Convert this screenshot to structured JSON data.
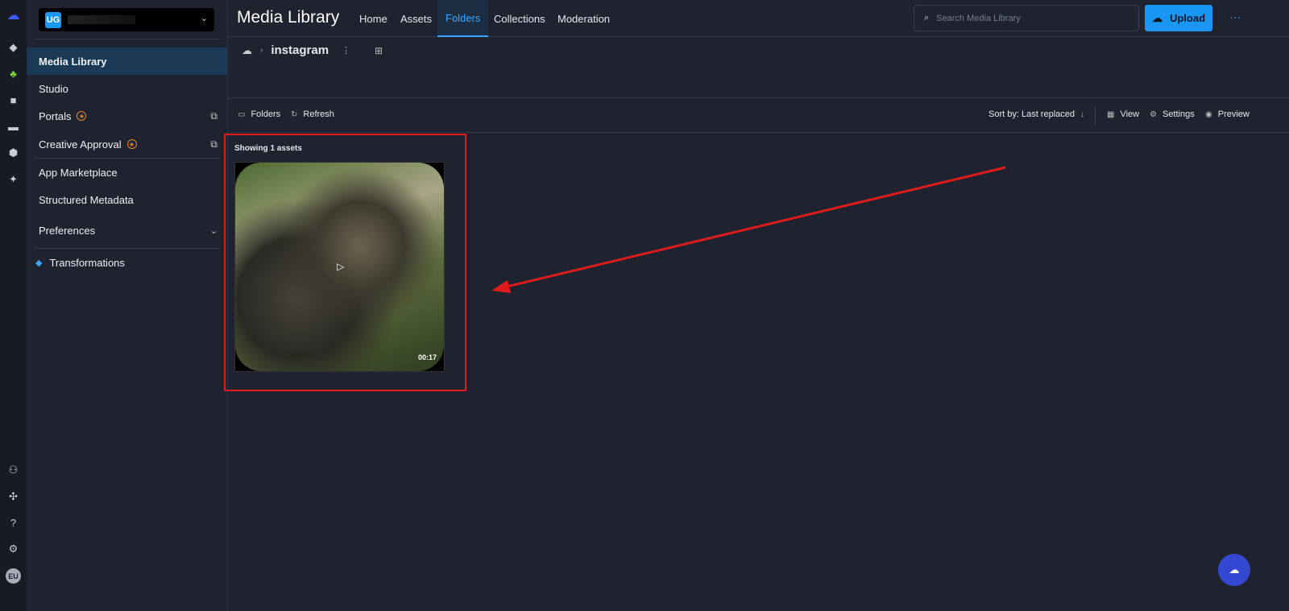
{
  "workspace": {
    "initials": "UG"
  },
  "sidebar": {
    "items": [
      {
        "label": "Media Library"
      },
      {
        "label": "Studio"
      },
      {
        "label": "Portals"
      },
      {
        "label": "Creative Approval"
      },
      {
        "label": "App Marketplace"
      },
      {
        "label": "Structured Metadata"
      },
      {
        "label": "Preferences"
      },
      {
        "label": "Transformations"
      }
    ]
  },
  "header": {
    "title": "Media Library",
    "tabs": [
      {
        "label": "Home"
      },
      {
        "label": "Assets"
      },
      {
        "label": "Folders"
      },
      {
        "label": "Collections"
      },
      {
        "label": "Moderation"
      }
    ],
    "search_placeholder": "Search Media Library",
    "upload_label": "Upload"
  },
  "breadcrumb": {
    "folder": "instagram"
  },
  "toolbar": {
    "folders": "Folders",
    "refresh": "Refresh",
    "sort": "Sort by: Last replaced",
    "view": "View",
    "settings": "Settings",
    "preview": "Preview"
  },
  "assets": {
    "count_text": "Showing 1 assets",
    "items": [
      {
        "duration": "00:17",
        "type": "video"
      }
    ]
  },
  "user": {
    "initials": "EU"
  },
  "colors": {
    "accent": "#1a97f5",
    "annotation": "#e01b1b"
  }
}
